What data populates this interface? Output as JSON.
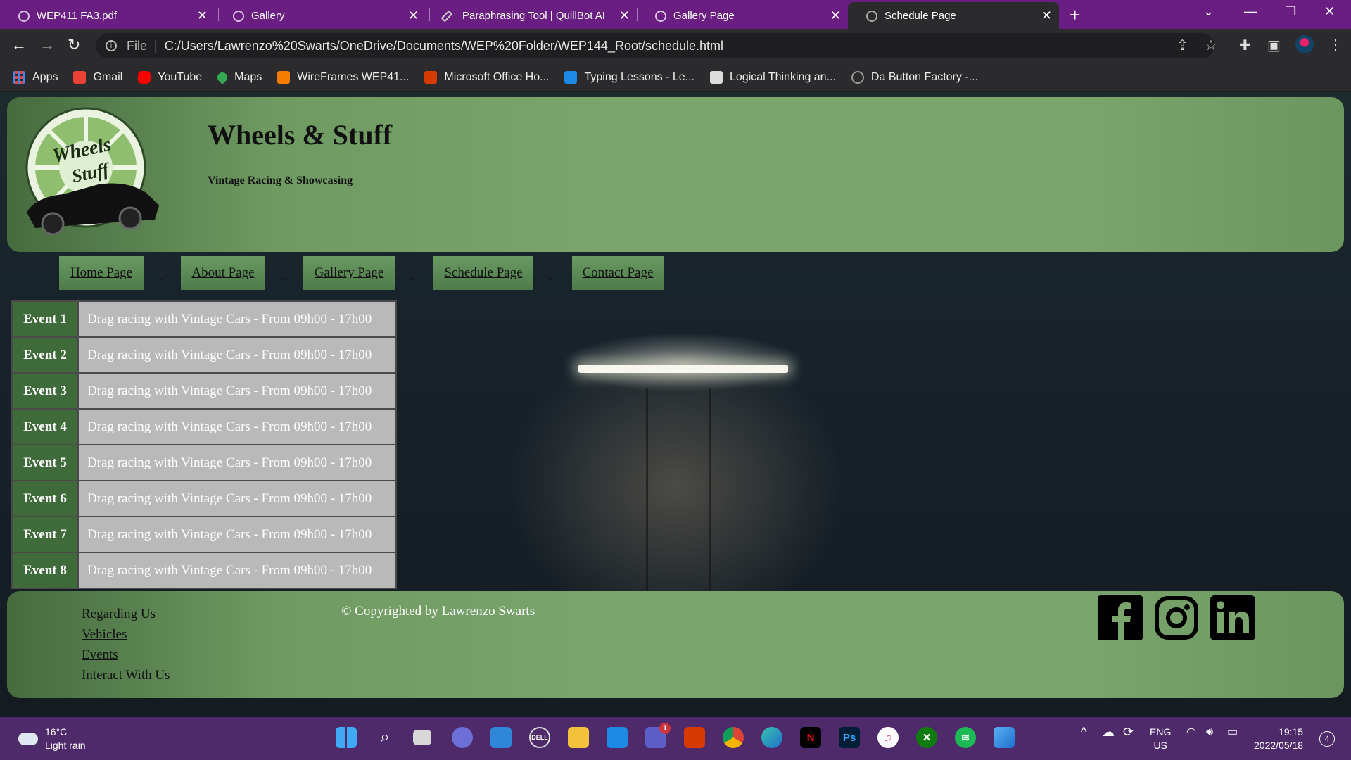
{
  "browser": {
    "tabs": [
      {
        "title": "WEP411 FA3.pdf"
      },
      {
        "title": "Gallery"
      },
      {
        "title": "Paraphrasing Tool | QuillBot AI"
      },
      {
        "title": "Gallery Page"
      },
      {
        "title": "Schedule Page"
      }
    ],
    "active_tab": 4,
    "address": {
      "scheme_label": "File",
      "url": "C:/Users/Lawrenzo%20Swarts/OneDrive/Documents/WEP%20Folder/WEP144_Root/schedule.html"
    },
    "bookmarks": [
      {
        "label": "Apps",
        "icon": "apps-grid-icon",
        "color": "#4285f4"
      },
      {
        "label": "Gmail",
        "icon": "gmail-icon",
        "color": "#ea4335"
      },
      {
        "label": "YouTube",
        "icon": "youtube-icon",
        "color": "#ff0000"
      },
      {
        "label": "Maps",
        "icon": "maps-pin-icon",
        "color": "#34a853"
      },
      {
        "label": "WireFrames WEP41...",
        "icon": "wireframes-icon",
        "color": "#f57c00"
      },
      {
        "label": "Microsoft Office Ho...",
        "icon": "office-icon",
        "color": "#d83b01"
      },
      {
        "label": "Typing Lessons - Le...",
        "icon": "typing-icon",
        "color": "#1e88e5"
      },
      {
        "label": "Logical Thinking an...",
        "icon": "ctu-icon",
        "color": "#dddddd"
      },
      {
        "label": "Da Button Factory -...",
        "icon": "globe-icon",
        "color": "#888888"
      }
    ]
  },
  "site": {
    "title": "Wheels & Stuff",
    "subtitle": "Vintage Racing & Showcasing",
    "logo_text": "Wheels Stuff",
    "nav": [
      {
        "label": "Home Page"
      },
      {
        "label": "About Page"
      },
      {
        "label": "Gallery Page"
      },
      {
        "label": "Schedule Page"
      },
      {
        "label": "Contact Page"
      }
    ],
    "nav_separator": "-",
    "schedule": [
      {
        "event": "Event 1",
        "description": "Drag racing with Vintage Cars - From 09h00 - 17h00"
      },
      {
        "event": "Event 2",
        "description": "Drag racing with Vintage Cars - From 09h00 - 17h00"
      },
      {
        "event": "Event 3",
        "description": "Drag racing with Vintage Cars - From 09h00 - 17h00"
      },
      {
        "event": "Event 4",
        "description": "Drag racing with Vintage Cars - From 09h00 - 17h00"
      },
      {
        "event": "Event 5",
        "description": "Drag racing with Vintage Cars - From 09h00 - 17h00"
      },
      {
        "event": "Event 6",
        "description": "Drag racing with Vintage Cars - From 09h00 - 17h00"
      },
      {
        "event": "Event 7",
        "description": "Drag racing with Vintage Cars - From 09h00 - 17h00"
      },
      {
        "event": "Event 8",
        "description": "Drag racing with Vintage Cars - From 09h00 - 17h00"
      }
    ],
    "footer": {
      "links": [
        "Regarding Us",
        "Vehicles",
        "Events",
        "Interact With Us"
      ],
      "copyright": "© Copyrighted by Lawrenzo Swarts",
      "social": [
        "facebook-icon",
        "instagram-icon",
        "linkedin-icon"
      ]
    }
  },
  "taskbar": {
    "weather": {
      "temp": "16°C",
      "condition": "Light rain"
    },
    "teams_badge": "1",
    "language": {
      "lang": "ENG",
      "region": "US"
    },
    "time": "19:15",
    "date": "2022/05/18",
    "notifications": "4"
  }
}
